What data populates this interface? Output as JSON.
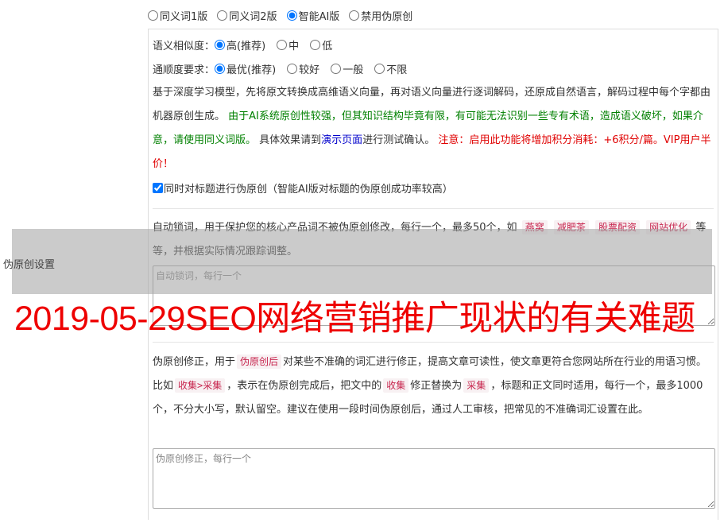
{
  "mode_options": [
    {
      "label": "同义词1版",
      "checked": false
    },
    {
      "label": "同义词2版",
      "checked": false
    },
    {
      "label": "智能AI版",
      "checked": true
    },
    {
      "label": "禁用伪原创",
      "checked": false
    }
  ],
  "similarity": {
    "label": "语义相似度：",
    "options": [
      {
        "label": "高(推荐)",
        "checked": true
      },
      {
        "label": "中",
        "checked": false
      },
      {
        "label": "低",
        "checked": false
      }
    ]
  },
  "fluency": {
    "label": "通顺度要求：",
    "options": [
      {
        "label": "最优(推荐)",
        "checked": true
      },
      {
        "label": "较好",
        "checked": false
      },
      {
        "label": "一般",
        "checked": false
      },
      {
        "label": "不限",
        "checked": false
      }
    ]
  },
  "desc": {
    "p1": "基于深度学习模型，先将原文转换成高维语义向量，再对语义向量进行逐词解码，还原成自然语言，解码过程中每个字都由机器原创生成。",
    "p2": "由于AI系统原创性较强，但其知识结构毕竟有限，有可能无法识别一些专有术语，造成语义破坏，如果介意，请使用同义词版。",
    "p3": "具体效果请到",
    "link": "演示页面",
    "p4": "进行测试确认。",
    "p5": "注意：启用此功能将增加积分消耗：+6积分/篇。VIP用户半价！"
  },
  "title_check": {
    "label": "同时对标题进行伪原创（智能AI版对标题的伪原创成功率较高）",
    "checked": true
  },
  "lock": {
    "t1": "自动锁词，用于保护您的核心产品词不被伪原创修改，每行一个，最多50个，如",
    "tags": [
      "燕窝",
      "减肥茶",
      "股票配资",
      "网站优化"
    ],
    "t2": "等等，并根据实际情况跟踪调整。",
    "placeholder": "自动锁词，每行一个"
  },
  "side_label": "伪原创设置",
  "watermark": "2019-05-29SEO网络营销推广现状的有关难题",
  "fix": {
    "t1": "伪原创修正，用于",
    "tag1": "伪原创后",
    "t2": "对某些不准确的词汇进行修正，提高文章可读性，使文章更符合您网站所在行业的用语习惯。比如",
    "tag2": "收集>采集",
    "t3": "，表示在伪原创完成后，把文中的",
    "tag3": "收集",
    "t4": "修正替换为",
    "tag4": "采集",
    "t5": "，标题和正文同时适用，每行一个，最多1000个，不分大小写，默认留空。建议在使用一段时间伪原创后，通过人工审核，把常见的不准确词汇设置在此。",
    "placeholder": "伪原创修正，每行一个"
  }
}
